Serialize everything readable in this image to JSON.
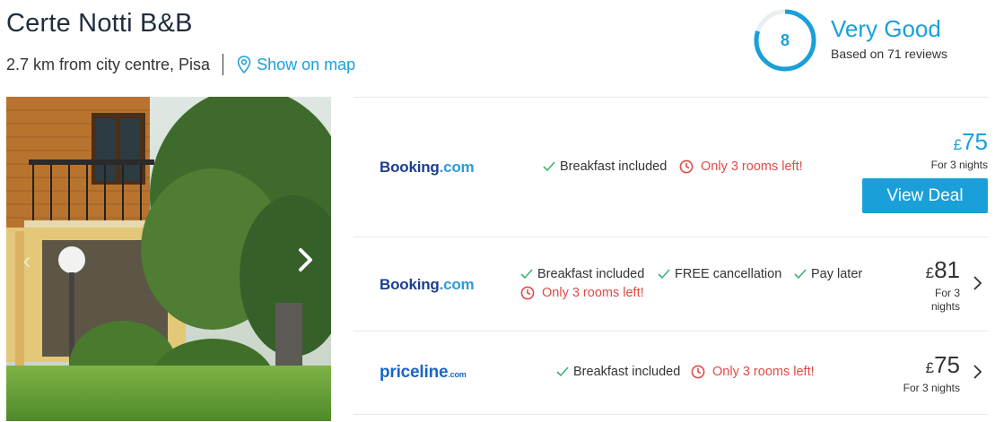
{
  "hotel": {
    "name": "Certe Notti B&B",
    "distance": "2.7 km from city centre, Pisa",
    "map_link": "Show on map"
  },
  "rating": {
    "score": "8",
    "score_fraction": 0.8,
    "label": "Very Good",
    "reviews": "Based on 71 reviews"
  },
  "colors": {
    "accent": "#1a9fd9",
    "warning": "#e24a45",
    "check": "#3cb371",
    "booking_dark": "#1c3f8f",
    "booking_light": "#2d9bdb",
    "priceline": "#1a65c6"
  },
  "photo": {
    "left_arrow": "‹",
    "right_arrow_icon": "chevron-right-icon"
  },
  "deals": [
    {
      "provider": {
        "part1": "Booking",
        "part2": ".com"
      },
      "features": [
        "Breakfast included"
      ],
      "warning": "Only 3 rooms left!",
      "currency": "£",
      "price": "75",
      "nights": "For 3 nights",
      "cta": "View Deal"
    },
    {
      "provider": {
        "part1": "Booking",
        "part2": ".com"
      },
      "features": [
        "Breakfast included",
        "FREE cancellation",
        "Pay later"
      ],
      "warning": "Only 3 rooms left!",
      "currency": "£",
      "price": "81",
      "nights_line1": "For 3",
      "nights_line2": "nights"
    },
    {
      "provider": {
        "part1": "priceline",
        "part2": ".com"
      },
      "features": [
        "Breakfast included"
      ],
      "warning": "Only 3 rooms left!",
      "currency": "£",
      "price": "75",
      "nights": "For 3 nights"
    }
  ]
}
